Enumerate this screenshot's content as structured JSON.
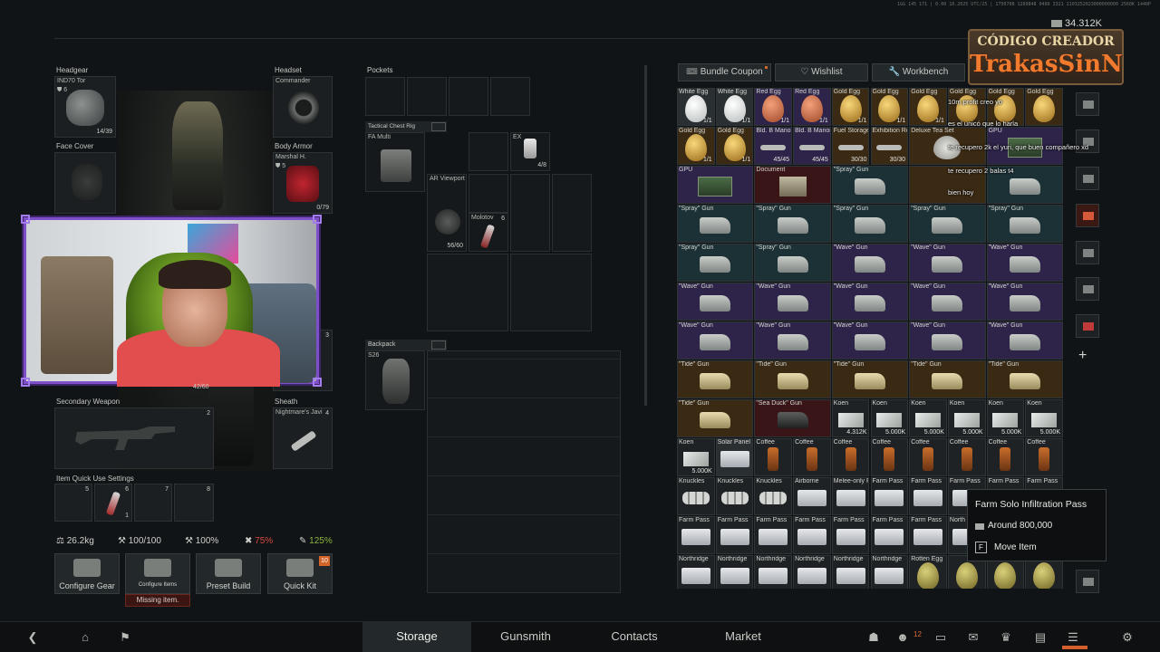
{
  "header": {
    "money": "34.312K",
    "info_icon": "i",
    "build_info": "1GG 145 171 | 0.00 10.2025 UTC/25 | 1750708 1289848 0486 3321 2103252023000000000 2560K 1440P"
  },
  "logo": {
    "line1": "CÓDIGO CREADOR",
    "line2": "TrakasSinN"
  },
  "gear": {
    "headgear": {
      "label": "Headgear",
      "item": "IND70 Tor",
      "stat": "6",
      "durability": "14/39"
    },
    "headset": {
      "label": "Headset",
      "item": "Commander"
    },
    "face_cover": {
      "label": "Face Cover"
    },
    "body_armor": {
      "label": "Body Armor",
      "item": "Marshal H.",
      "stat": "5",
      "durability": "0/79"
    },
    "side_count": "3",
    "primary_ammo": "42/60",
    "secondary": {
      "label": "Secondary Weapon",
      "count": "2"
    },
    "sheath": {
      "label": "Sheath",
      "item": "Nightmare's Javi",
      "count": "4"
    },
    "quick_use": {
      "label": "Item Quick Use Settings",
      "slots": [
        "5",
        "6",
        "7",
        "8"
      ],
      "slot_count": "1"
    }
  },
  "stats": {
    "weight": "26.2kg",
    "durability": "100/100",
    "armor": "100%",
    "overweight": "75%",
    "bonus": "125%"
  },
  "tools": {
    "configure_gear": "Configure Gear",
    "configure_items": "Configure Items",
    "preset_build": "Preset Build",
    "quick_kit": "Quick Kit",
    "quick_kit_badge": "10",
    "missing": "Missing item."
  },
  "rig": {
    "pockets_label": "Pockets",
    "tactical_rig_label": "Tactical Chest Rig",
    "rig_item": "FA Multi",
    "ex_label": "EX",
    "ex_count": "4/8",
    "ar_label": "AR Viewport",
    "ar_count": "56/60",
    "molotov_label": "Molotov",
    "molotov_count": "6",
    "backpack_label": "Backpack",
    "backpack_item": "S26"
  },
  "stash": {
    "tabs": [
      "Bundle Coupon",
      "Wishlist",
      "Workbench"
    ],
    "rows": [
      [
        {
          "n": "White Egg",
          "c": "1/1",
          "t": "egg-white",
          "bg": "grey"
        },
        {
          "n": "White Egg",
          "c": "1/1",
          "t": "egg-white",
          "bg": "grey"
        },
        {
          "n": "Red Egg",
          "c": "1/1",
          "t": "egg-red",
          "bg": "violet"
        },
        {
          "n": "Red Egg",
          "c": "1/1",
          "t": "egg-red",
          "bg": "violet"
        },
        {
          "n": "Gold Egg",
          "c": "1/1",
          "t": "egg-gold",
          "bg": "orange"
        },
        {
          "n": "Gold Egg",
          "c": "1/1",
          "t": "egg-gold",
          "bg": "orange"
        },
        {
          "n": "Gold Egg",
          "c": "1/1",
          "t": "egg-gold",
          "bg": "orange"
        },
        {
          "n": "Gold Egg",
          "c": "",
          "t": "egg-gold",
          "bg": "orange"
        },
        {
          "n": "Gold Egg",
          "c": "",
          "t": "egg-gold",
          "bg": "orange"
        },
        {
          "n": "Gold Egg",
          "c": "",
          "t": "egg-gold",
          "bg": "orange"
        }
      ],
      [
        {
          "n": "Gold Egg",
          "c": "1/1",
          "t": "egg-gold",
          "bg": "orange"
        },
        {
          "n": "Gold Egg",
          "c": "1/1",
          "t": "egg-gold",
          "bg": "orange"
        },
        {
          "n": "Bld. B Manor",
          "c": "45/45",
          "t": "key",
          "bg": "violet"
        },
        {
          "n": "Bld. B Manor",
          "c": "45/45",
          "t": "key",
          "bg": "violet"
        },
        {
          "n": "Fuel Storage",
          "c": "30/30",
          "t": "key",
          "bg": "orange"
        },
        {
          "n": "Exhibition Room",
          "c": "30/30",
          "t": "key",
          "bg": "orange"
        },
        {
          "n": "Deluxe Tea Set",
          "c": "",
          "t": "tea",
          "bg": "orange",
          "w": 2
        },
        {
          "n": "GPU",
          "c": "",
          "t": "gpu",
          "bg": "violet",
          "w": 2
        }
      ],
      [
        {
          "n": "GPU",
          "c": "",
          "t": "gpu",
          "bg": "violet",
          "w": 2
        },
        {
          "n": "Document",
          "c": "",
          "t": "doc",
          "bg": "red",
          "w": 2
        },
        {
          "n": "\"Spray\" Gun",
          "c": "",
          "t": "pistol",
          "bg": "teal",
          "w": 2
        },
        {
          "n": "",
          "c": "",
          "t": "",
          "bg": "orange",
          "w": 2
        },
        {
          "n": "",
          "c": "",
          "t": "pistol",
          "bg": "teal",
          "w": 2
        }
      ],
      [
        {
          "n": "\"Spray\" Gun",
          "c": "",
          "t": "pistol",
          "bg": "teal",
          "w": 2
        },
        {
          "n": "\"Spray\" Gun",
          "c": "",
          "t": "pistol",
          "bg": "teal",
          "w": 2
        },
        {
          "n": "\"Spray\" Gun",
          "c": "",
          "t": "pistol",
          "bg": "teal",
          "w": 2
        },
        {
          "n": "\"Spray\" Gun",
          "c": "",
          "t": "pistol",
          "bg": "teal",
          "w": 2
        },
        {
          "n": "\"Spray\" Gun",
          "c": "",
          "t": "pistol",
          "bg": "teal",
          "w": 2
        }
      ],
      [
        {
          "n": "\"Spray\" Gun",
          "c": "",
          "t": "pistol",
          "bg": "teal",
          "w": 2
        },
        {
          "n": "\"Spray\" Gun",
          "c": "",
          "t": "pistol",
          "bg": "teal",
          "w": 2
        },
        {
          "n": "\"Wave\" Gun",
          "c": "",
          "t": "pistol",
          "bg": "violet",
          "w": 2
        },
        {
          "n": "\"Wave\" Gun",
          "c": "",
          "t": "pistol",
          "bg": "violet",
          "w": 2
        },
        {
          "n": "\"Wave\" Gun",
          "c": "",
          "t": "pistol",
          "bg": "violet",
          "w": 2
        }
      ],
      [
        {
          "n": "\"Wave\" Gun",
          "c": "",
          "t": "pistol",
          "bg": "violet",
          "w": 2
        },
        {
          "n": "\"Wave\" Gun",
          "c": "",
          "t": "pistol",
          "bg": "violet",
          "w": 2
        },
        {
          "n": "\"Wave\" Gun",
          "c": "",
          "t": "pistol",
          "bg": "violet",
          "w": 2
        },
        {
          "n": "\"Wave\" Gun",
          "c": "",
          "t": "pistol",
          "bg": "violet",
          "w": 2
        },
        {
          "n": "\"Wave\" Gun",
          "c": "",
          "t": "pistol",
          "bg": "violet",
          "w": 2
        }
      ],
      [
        {
          "n": "\"Wave\" Gun",
          "c": "",
          "t": "pistol",
          "bg": "violet",
          "w": 2
        },
        {
          "n": "\"Wave\" Gun",
          "c": "",
          "t": "pistol",
          "bg": "violet",
          "w": 2
        },
        {
          "n": "\"Wave\" Gun",
          "c": "",
          "t": "pistol",
          "bg": "violet",
          "w": 2
        },
        {
          "n": "\"Wave\" Gun",
          "c": "",
          "t": "pistol",
          "bg": "violet",
          "w": 2
        },
        {
          "n": "\"Wave\" Gun",
          "c": "",
          "t": "pistol",
          "bg": "violet",
          "w": 2
        }
      ],
      [
        {
          "n": "\"Tide\" Gun",
          "c": "",
          "t": "pistol-gold",
          "bg": "orange",
          "w": 2
        },
        {
          "n": "\"Tide\" Gun",
          "c": "",
          "t": "pistol-gold",
          "bg": "orange",
          "w": 2
        },
        {
          "n": "\"Tide\" Gun",
          "c": "",
          "t": "pistol-gold",
          "bg": "orange",
          "w": 2
        },
        {
          "n": "\"Tide\" Gun",
          "c": "",
          "t": "pistol-gold",
          "bg": "orange",
          "w": 2
        },
        {
          "n": "\"Tide\" Gun",
          "c": "",
          "t": "pistol-gold",
          "bg": "orange",
          "w": 2
        }
      ],
      [
        {
          "n": "\"Tide\" Gun",
          "c": "",
          "t": "pistol-gold",
          "bg": "orange",
          "w": 2
        },
        {
          "n": "\"Sea Duck\" Gun",
          "c": "",
          "t": "pistol-dark",
          "bg": "red",
          "w": 2
        },
        {
          "n": "Koen",
          "c": "4.312K",
          "t": "cash",
          "bg": "dark"
        },
        {
          "n": "Koen",
          "c": "5.000K",
          "t": "cash",
          "bg": "dark"
        },
        {
          "n": "Koen",
          "c": "5.000K",
          "t": "cash",
          "bg": "dark"
        },
        {
          "n": "Koen",
          "c": "5.000K",
          "t": "cash",
          "bg": "dark"
        },
        {
          "n": "Koen",
          "c": "5.000K",
          "t": "cash",
          "bg": "dark"
        },
        {
          "n": "Koen",
          "c": "5.000K",
          "t": "cash",
          "bg": "dark"
        }
      ],
      [
        {
          "n": "Koen",
          "c": "5.000K",
          "t": "cash",
          "bg": "dark"
        },
        {
          "n": "Solar Panel",
          "c": "",
          "t": "card",
          "bg": "grey"
        },
        {
          "n": "Coffee",
          "c": "",
          "t": "coffee",
          "bg": "dark"
        },
        {
          "n": "Coffee",
          "c": "",
          "t": "coffee",
          "bg": "dark"
        },
        {
          "n": "Coffee",
          "c": "",
          "t": "coffee",
          "bg": "dark"
        },
        {
          "n": "Coffee",
          "c": "",
          "t": "coffee",
          "bg": "dark"
        },
        {
          "n": "Coffee",
          "c": "",
          "t": "coffee",
          "bg": "dark"
        },
        {
          "n": "Coffee",
          "c": "",
          "t": "coffee",
          "bg": "dark"
        },
        {
          "n": "Coffee",
          "c": "",
          "t": "coffee",
          "bg": "dark"
        },
        {
          "n": "Coffee",
          "c": "",
          "t": "coffee",
          "bg": "dark"
        }
      ],
      [
        {
          "n": "Knuckles",
          "c": "",
          "t": "knuck",
          "bg": "dark"
        },
        {
          "n": "Knuckles",
          "c": "",
          "t": "knuck",
          "bg": "dark"
        },
        {
          "n": "Knuckles",
          "c": "",
          "t": "knuck",
          "bg": "dark"
        },
        {
          "n": "Airborne",
          "c": "",
          "t": "card",
          "bg": "dark"
        },
        {
          "n": "Melee-only Pass",
          "c": "",
          "t": "card",
          "bg": "dark"
        },
        {
          "n": "Farm Pass",
          "c": "",
          "t": "card",
          "bg": "dark"
        },
        {
          "n": "Farm Pass",
          "c": "",
          "t": "card",
          "bg": "dark"
        },
        {
          "n": "Farm Pass",
          "c": "",
          "t": "card",
          "bg": "dark"
        },
        {
          "n": "Farm Pass",
          "c": "",
          "t": "card",
          "bg": "dark"
        },
        {
          "n": "Farm Pass",
          "c": "",
          "t": "card",
          "bg": "dark"
        }
      ],
      [
        {
          "n": "Farm Pass",
          "c": "",
          "t": "card",
          "bg": "dark"
        },
        {
          "n": "Farm Pass",
          "c": "",
          "t": "card",
          "bg": "dark"
        },
        {
          "n": "Farm Pass",
          "c": "",
          "t": "card",
          "bg": "dark"
        },
        {
          "n": "Farm Pass",
          "c": "",
          "t": "card",
          "bg": "dark"
        },
        {
          "n": "Farm Pass",
          "c": "",
          "t": "card",
          "bg": "dark"
        },
        {
          "n": "Farm Pass",
          "c": "",
          "t": "card",
          "bg": "dark"
        },
        {
          "n": "Farm Pass",
          "c": "",
          "t": "card",
          "bg": "dark"
        },
        {
          "n": "North",
          "c": "",
          "t": "card",
          "bg": "dark"
        },
        {
          "n": "North",
          "c": "",
          "t": "card",
          "bg": "dark"
        },
        {
          "n": "",
          "c": "",
          "t": "",
          "bg": "dark"
        }
      ],
      [
        {
          "n": "Northridge",
          "c": "",
          "t": "card",
          "bg": "dark"
        },
        {
          "n": "Northridge",
          "c": "",
          "t": "card",
          "bg": "dark"
        },
        {
          "n": "Northridge",
          "c": "",
          "t": "card",
          "bg": "dark"
        },
        {
          "n": "Northridge",
          "c": "",
          "t": "card",
          "bg": "dark"
        },
        {
          "n": "Northridge",
          "c": "",
          "t": "card",
          "bg": "dark"
        },
        {
          "n": "Northridge",
          "c": "",
          "t": "card",
          "bg": "dark"
        },
        {
          "n": "Rotten Egg",
          "c": "",
          "t": "egg-rot",
          "bg": "dark"
        },
        {
          "n": "",
          "c": "",
          "t": "egg-rot",
          "bg": "dark"
        },
        {
          "n": "",
          "c": "",
          "t": "egg-rot",
          "bg": "dark"
        },
        {
          "n": "",
          "c": "",
          "t": "egg-rot",
          "bg": "dark"
        }
      ]
    ]
  },
  "chat": [
    "10m profit creo yo",
    "es el unicó que lo harla",
    "te recupero 2k el yuri, que buen compañero xd",
    "te recupero 2 balas t4",
    "bien hoy"
  ],
  "tooltip": {
    "title": "Farm Solo Infiltration Pass",
    "price": "Around 800,000",
    "key": "F",
    "action": "Move Item"
  },
  "nav": {
    "tabs": [
      "Storage",
      "Gunsmith",
      "Contacts",
      "Market"
    ],
    "active": "Storage",
    "friends_badge": "12"
  },
  "colors": {
    "accent": "#d4662a",
    "webcam_border": "#7e4fc9",
    "red_stat": "#d54a3f",
    "green_stat": "#8ab53e"
  }
}
